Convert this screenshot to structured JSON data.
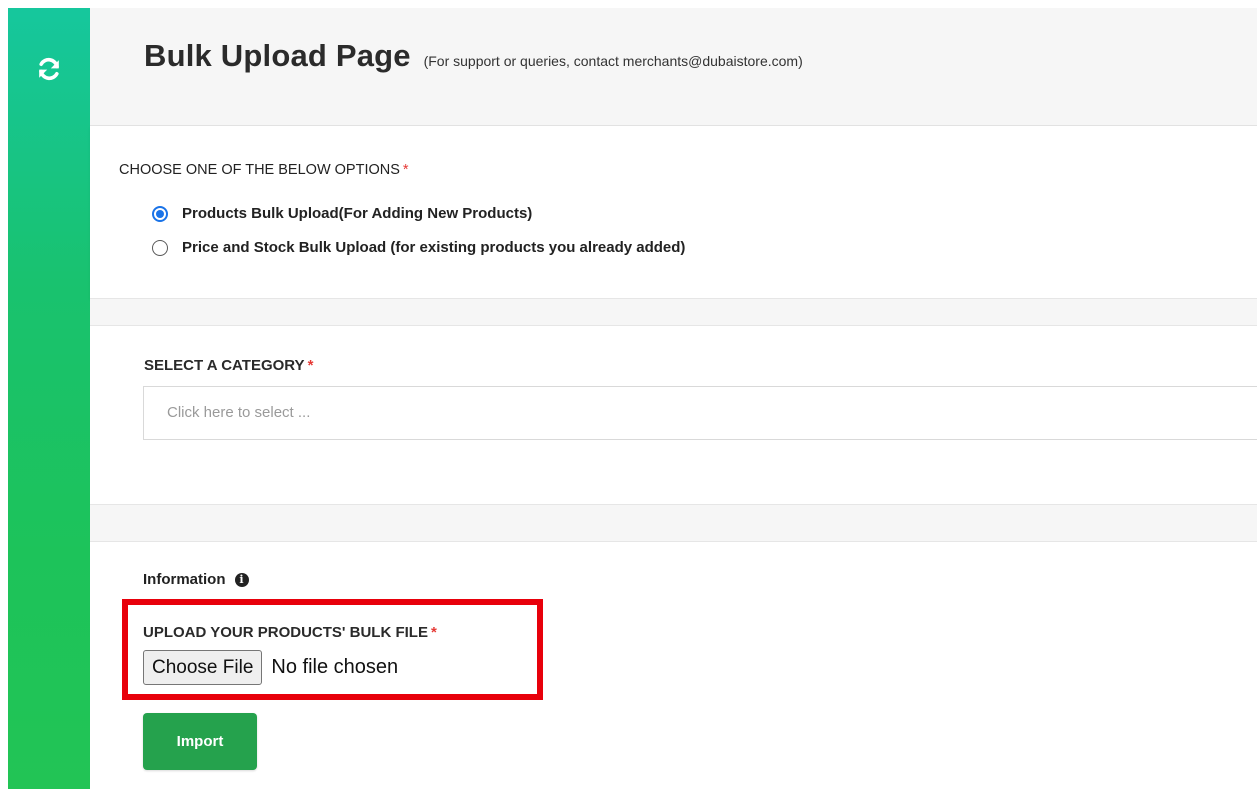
{
  "header": {
    "title": "Bulk Upload Page",
    "subtitle": "(For support or queries, contact merchants@dubaistore.com)"
  },
  "sidebar": {
    "icon": "refresh-icon",
    "gradient_colors": [
      "#16c79d",
      "#22c455"
    ]
  },
  "options": {
    "heading": "CHOOSE ONE OF THE BELOW OPTIONS",
    "required_mark": "*",
    "items": [
      {
        "label": "Products Bulk Upload(For Adding New Products)",
        "selected": true
      },
      {
        "label": "Price and Stock Bulk Upload (for existing products you already added)",
        "selected": false
      }
    ]
  },
  "category": {
    "heading": "SELECT A CATEGORY",
    "required_mark": "*",
    "placeholder": "Click here to select ..."
  },
  "upload": {
    "info_label": "Information",
    "info_icon": "info-icon",
    "heading": "UPLOAD YOUR PRODUCTS' BULK FILE",
    "required_mark": "*",
    "choose_button": "Choose File",
    "file_status": "No file chosen",
    "import_button": "Import"
  },
  "colors": {
    "accent_green": "#25a24d",
    "highlight_red": "#e8000b",
    "radio_blue": "#1a73e8",
    "required_red": "#e53935"
  }
}
